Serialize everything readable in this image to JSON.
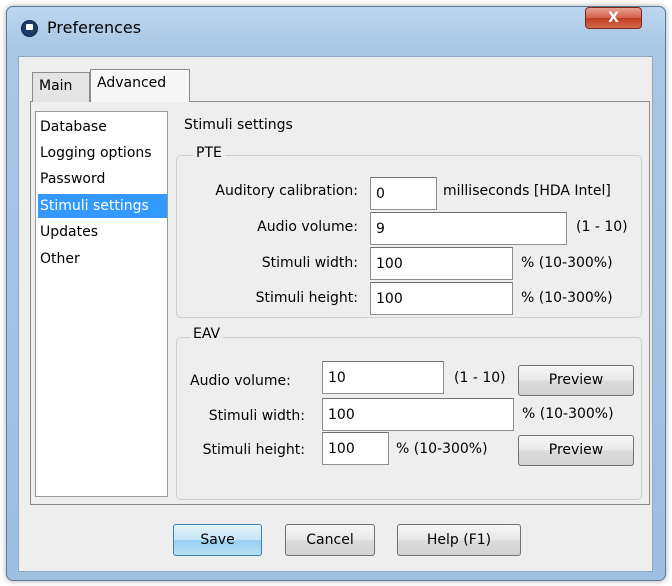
{
  "window": {
    "title": "Preferences",
    "close_glyph": "X"
  },
  "tabs": [
    {
      "label": "Main",
      "selected": false
    },
    {
      "label": "Advanced",
      "selected": true
    }
  ],
  "nav": {
    "items": [
      "Database",
      "Logging options",
      "Password",
      "Stimuli settings",
      "Updates",
      "Other"
    ],
    "selected": "Stimuli settings",
    "selected_color": "#3399ff"
  },
  "stimuli": {
    "title": "Stimuli settings",
    "pte": {
      "title": "PTE",
      "auditory_calibration": {
        "label": "Auditory calibration:",
        "value": "0",
        "suffix": "milliseconds [HDA Intel]"
      },
      "audio_volume": {
        "label": "Audio volume:",
        "value": "9",
        "suffix": "(1 - 10)"
      },
      "stimuli_width": {
        "label": "Stimuli width:",
        "value": "100",
        "suffix": "% (10-300%)"
      },
      "stimuli_height": {
        "label": "Stimuli height:",
        "value": "100",
        "suffix": "% (10-300%)"
      }
    },
    "eav": {
      "title": "EAV",
      "audio_volume": {
        "label": "Audio volume:",
        "value": "10",
        "suffix": "(1 - 10)",
        "button": "Preview"
      },
      "stimuli_width": {
        "label": "Stimuli width:",
        "value": "100",
        "suffix": "% (10-300%)"
      },
      "stimuli_height": {
        "label": "Stimuli height:",
        "value": "100",
        "suffix": "% (10-300%)",
        "button": "Preview"
      }
    }
  },
  "footer": {
    "save": "Save",
    "cancel": "Cancel",
    "help": "Help (F1)"
  }
}
